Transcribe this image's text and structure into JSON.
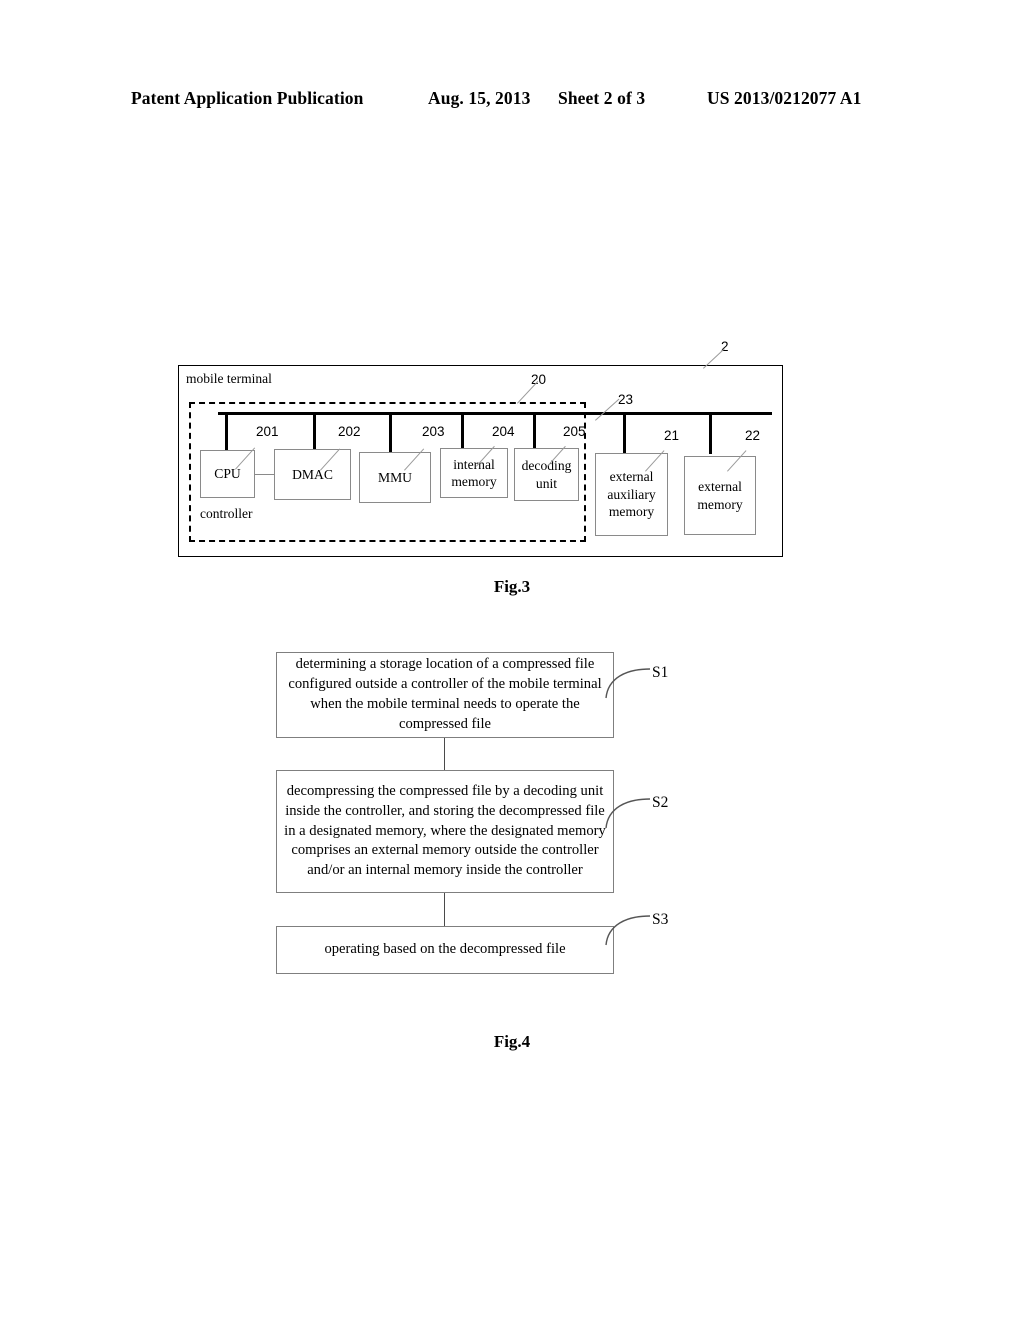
{
  "header": {
    "publication": "Patent Application Publication",
    "date": "Aug. 15, 2013",
    "sheet": "Sheet 2 of 3",
    "patent_number": "US 2013/0212077 A1"
  },
  "fig3": {
    "caption": "Fig.3",
    "outer_label": "mobile terminal",
    "outer_ref": "2",
    "controller_label": "controller",
    "controller_ref": "20",
    "bus_ref": "23",
    "blocks": [
      {
        "label": "CPU",
        "ref": "201"
      },
      {
        "label": "DMAC",
        "ref": "202"
      },
      {
        "label": "MMU",
        "ref": "203"
      },
      {
        "label": "internal memory",
        "ref": "204"
      },
      {
        "label": "decoding unit",
        "ref": "205"
      },
      {
        "label": "external auxiliary memory",
        "ref": "21"
      },
      {
        "label": "external memory",
        "ref": "22"
      }
    ]
  },
  "fig4": {
    "caption": "Fig.4",
    "steps": [
      {
        "id": "S1",
        "text": "determining a storage location of a compressed file configured outside a controller of the mobile terminal when the mobile terminal needs to operate the compressed file"
      },
      {
        "id": "S2",
        "text": "decompressing the compressed file by a decoding unit inside the controller, and storing the decompressed file in a designated memory, where the designated memory comprises an external memory outside the controller and/or an internal memory inside the controller"
      },
      {
        "id": "S3",
        "text": "operating based on the decompressed file"
      }
    ]
  }
}
